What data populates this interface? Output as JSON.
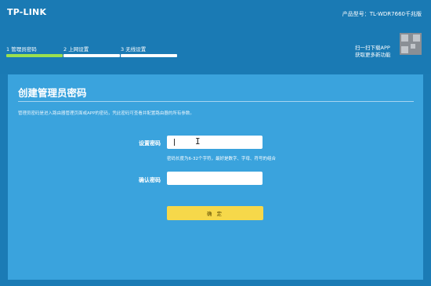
{
  "header": {
    "logo": "TP-LINK",
    "model": "产品型号：TL-WDR7660千兆版",
    "app_line1": "扫一扫下载APP",
    "app_line2": "获取更多新功能"
  },
  "steps": [
    {
      "label": "1 管理员密码",
      "active": true
    },
    {
      "label": "2 上网设置",
      "active": false
    },
    {
      "label": "3 无线设置",
      "active": false
    }
  ],
  "panel": {
    "title": "创建管理员密码",
    "description": "管理员密码是进入路由器管理页面或APP的密码，凭此密码可查看并配置路由器的所有参数。",
    "password_label": "设置密码",
    "password_value": "",
    "hint": "密码长度为6-32个字符，最好是数字、字母、符号的组合",
    "confirm_label": "确认密码",
    "confirm_value": "",
    "submit_label": "确 定"
  },
  "colors": {
    "header_bg": "#1a7ab4",
    "panel_bg": "#3aa3dd",
    "active_step": "#9be04f",
    "button": "#f6d84a"
  }
}
